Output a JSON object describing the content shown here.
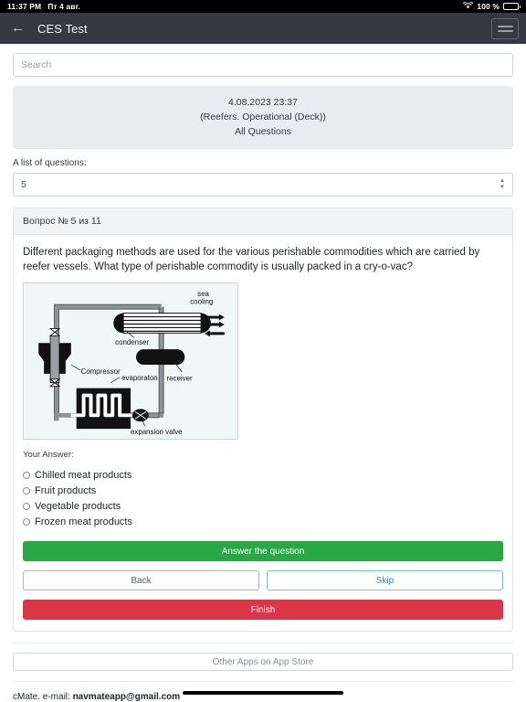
{
  "status_bar": {
    "time": "11:37 PM",
    "date": "Пт 4 авг.",
    "battery_percent": "100 %",
    "wifi_icon": "wifi-icon",
    "battery_icon": "battery-icon"
  },
  "navbar": {
    "back_icon": "back-arrow-icon",
    "title": "CES Test",
    "menu_icon": "hamburger-menu-icon"
  },
  "search": {
    "placeholder": "Search",
    "value": ""
  },
  "info_card": {
    "datetime": "4.08.2023 23:37",
    "category": "(Reefers. Operational (Deck))",
    "scope": "All Questions"
  },
  "question_selector": {
    "label": "A list of questions:",
    "value": "5",
    "stepper_icon": "stepper-chevrons-icon"
  },
  "question": {
    "header": "Вопрос № 5 из 11",
    "text": "Different packaging methods are used for the various perishable commodities which are carried by reefer vessels. What type of perishable commodity is usually packed in a cry-o-vac?",
    "answer_label": "Your Answer:",
    "options": [
      {
        "label": "Chilled meat products",
        "selected": false
      },
      {
        "label": "Fruit products",
        "selected": false
      },
      {
        "label": "Vegetable products",
        "selected": false
      },
      {
        "label": "Frozen meat products",
        "selected": false
      }
    ]
  },
  "diagram": {
    "name": "refrigeration-cycle-diagram",
    "labels": {
      "sea_cooling_line1": "sea",
      "sea_cooling_line2": "cooling",
      "condenser": "condenser",
      "compressor": "Compressor",
      "evaporator": "evaporaton",
      "receiver": "receiver",
      "expansion_valve": "expansion valve"
    }
  },
  "buttons": {
    "answer": "Answer the question",
    "back": "Back",
    "skip": "Skip",
    "finish": "Finish",
    "store": "Other Apps on App Store"
  },
  "footer": {
    "prefix": "cMate. e-mail: ",
    "email": "navmateapp@gmail.com"
  },
  "colors": {
    "navbar": "#343a40",
    "answer_green": "#28a745",
    "finish_red": "#dc3545",
    "skip_blue": "#2b8ae4",
    "info_card_bg": "#e9ecef"
  }
}
